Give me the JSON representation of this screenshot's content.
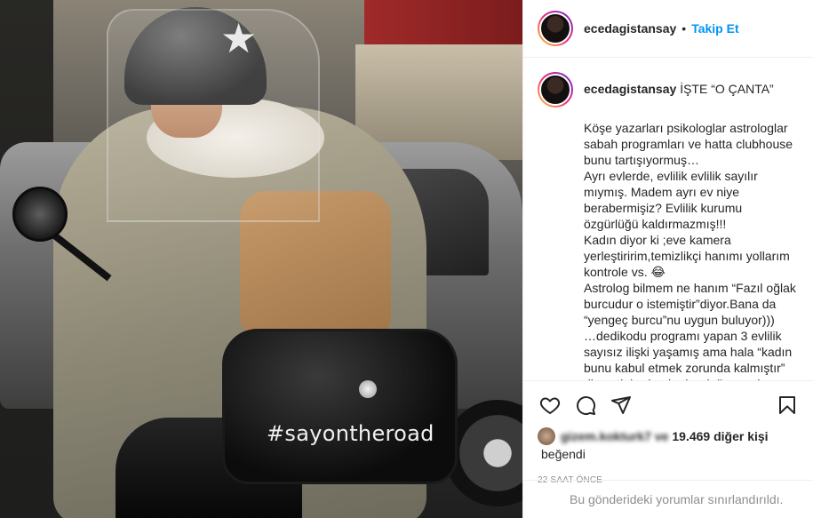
{
  "photo": {
    "topcase_text": "#sayontheroad"
  },
  "header": {
    "username": "ecedagistansay",
    "separator": "•",
    "follow_label": "Takip Et"
  },
  "caption": {
    "username": "ecedagistansay",
    "title": "İŞTE “O ÇANTA”",
    "body": "Köşe yazarları psikologlar astrologlar sabah programları ve hatta clubhouse bunu tartışıyormuş…\nAyrı evlerde, evlilik evlilik sayılır mıymış. Madem ayrı ev niye berabermişiz? Evlilik kurumu özgürlüğü kaldırmazmış!!!\nKadın diyor ki ;eve kamera yerleştiririm,temizlikçi hanımı yollarım kontrole vs. 😂\nAstrolog bilmem ne hanım “Fazıl oğlak burcudur o istemiştir”diyor.Bana da “yengeç burcu”nu uygun buluyor)))\n…dedikodu programı yapan 3 evlilik sayısız ilişki yaşamış ama hala “kadın bunu kabul etmek zorunda kalmıştır” diyen tiplerden bu kurduğumuz bu"
  },
  "actions": {
    "like_icon": "heart-icon",
    "comment_icon": "comment-icon",
    "share_icon": "paper-plane-icon",
    "save_icon": "bookmark-icon"
  },
  "likes": {
    "liker_name": "gizem.kokturk7 ve",
    "count_text": "19.469 diğer kişi",
    "suffix": "beğendi"
  },
  "timestamp": "22 SAAT ÖNCE",
  "comments_notice": "Bu gönderideki yorumlar sınırlandırıldı."
}
